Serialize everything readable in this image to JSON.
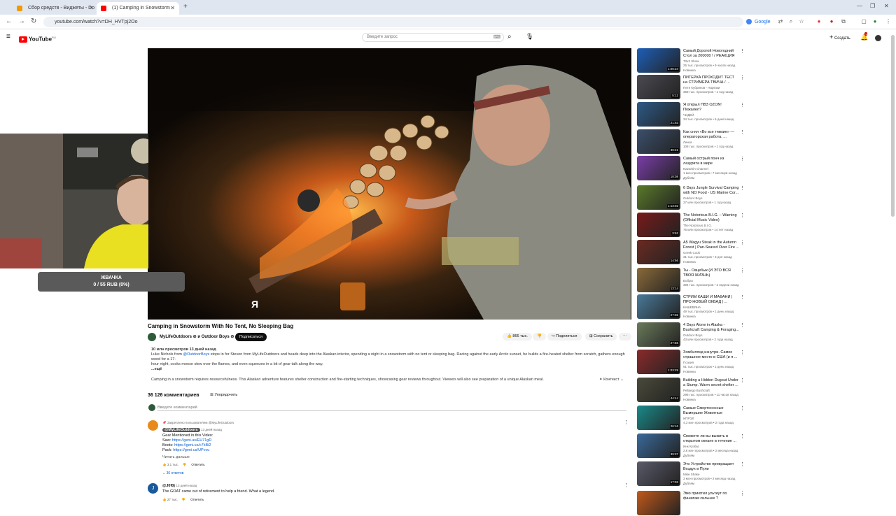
{
  "tabs": [
    {
      "title": "Сбор средств - Виджеты - Do",
      "color": "#f29900"
    },
    {
      "title": "(1) Camping in Snowstorm",
      "color": "#ff0000"
    }
  ],
  "address": {
    "url": "youtube.com/watch?v=DH_HVTpj2Oo"
  },
  "toolbar": {
    "google_label": "Google"
  },
  "header": {
    "logo_text": "YouTube",
    "logo_suffix": "RU",
    "search_placeholder": "Введите запрос",
    "create_label": "Создать",
    "notif_count": "1"
  },
  "donation": {
    "title": "ЖВАЧКА",
    "progress": "0 / 55 RUB (0%)",
    "progress_fraction": 0
  },
  "video": {
    "overlay_letter": "Я",
    "title": "Camping in Snowstorm With No Tent, No Sleeping Bag",
    "channel": "MyLifeOutdoors ⊘ и Outdoor Boys ⊘",
    "subscribe": "Подписаться",
    "likes": "866 тыс.",
    "share": "Поделиться",
    "save": "Сохранить",
    "views_line": "10 млн просмотров  13 дней назад",
    "desc1_a": "Luke Nichols from ",
    "desc1_link": "@OutdoorBoys",
    "desc1_b": " stops in for Steven from MyLifeOutdoors and heads deep into the Alaskan interior, spending a night in a snowstorm with no tent or sleeping bag. Racing against the early Arctic sunset, he builds a fire-heated shelter from scratch, gathers enough wood for a 17-",
    "desc2": "hour night, cooks moose stew over the flames, and even squeezes in a bit of gear talk along the way.",
    "more": "...ещё",
    "summary": "Camping in a snowstorm requires resourcefulness. This Alaskan adventure features shelter construction and fire-starting techniques, showcasing gear reviews throughout. Viewers will also see preparation of a unique Alaskan meal.",
    "context_btn": "Контекст"
  },
  "comments": {
    "count": "36 126 комментариев",
    "sort": "Упорядочить",
    "add_placeholder": "Введите комментарий",
    "pinned_label": "Закреплено пользователем @MyLifeOutdoors",
    "c1_author": "@MyLifeOutdoors",
    "c1_time": "13 дней назад",
    "c1_l1": "Gear Mentioned in this Video:",
    "c1_l2a": "Saw: ",
    "c1_l2b": "https://geni.us/EH71gR",
    "c1_l3a": "Boots: ",
    "c1_l3b": "https://geni.us/c7kBi2",
    "c1_l4a": "Pack: ",
    "c1_l4b": "https://geni.us/UPcvu",
    "c1_more": "Читать дальше",
    "c1_likes": "3,1 тыс.",
    "c1_reply": "Ответить",
    "c1_replies": "36 ответов",
    "c2_author": "@J0f0j",
    "c2_time": "13 дней назад",
    "c2_text": "The GOAT came out of retirement to help a friend.  What a legend.",
    "c2_likes": "27 тыс.",
    "c2_reply": "Ответить"
  },
  "sidebar": [
    {
      "title": "Самый Дорогой Новогодний Стол за 200000 ! / РЕАКЦИЯ",
      "channel": "T2x2 Show",
      "meta": "25 тыс. просмотров • 9 часов назад",
      "badge": "Новинка",
      "dur": "1:06:24",
      "color": "#1d5fb8"
    },
    {
      "title": "ПИТЕРКА ПРОХОДИТ ТЕСТ на СТРИМЕРА ТВИЧА / ...",
      "channel": "Петя Кубринов - Нарезки",
      "meta": "358 тыс. просмотров • 1 год назад",
      "badge": "",
      "dur": "5:12",
      "color": "#4a4a52"
    },
    {
      "title": "Я открыл ПВЗ OZON! Пожалел?",
      "channel": "ЧИДЕЙ",
      "meta": "34 тыс. просмотров • 6 дней назад",
      "badge": "",
      "dur": "21:53",
      "color": "#2d5a87"
    },
    {
      "title": "Как снял «Во все тяжкие» — операторская работа, ...",
      "channel": "Линза",
      "meta": "108 тыс. просмотров • 1 год назад",
      "badge": "",
      "dur": "30:21",
      "color": "#3b4f6b"
    },
    {
      "title": "Самый острый понч из лазурита в мире",
      "channel": "Nazarkin Channel",
      "meta": "1 млн просмотров • 7 месяцев назад",
      "badge": "Дублям",
      "dur": "18:08",
      "color": "#7a3ea8"
    },
    {
      "title": "6 Days Jungle Survival Camping with NO Food - US Marine Cor...",
      "channel": "Outdoor Boys",
      "meta": "37 млн просмотров • 1 год назад",
      "badge": "",
      "dur": "1:13:02",
      "color": "#5a7a2a"
    },
    {
      "title": "The Notorious B.I.G. – Warning (Official Music Video)",
      "channel": "The Notorious B.I.G.",
      "meta": "76 млн просмотров • 14 лет назад",
      "badge": "",
      "dur": "3:52",
      "color": "#7a1a1a"
    },
    {
      "title": "A5 Wagyu Steak in the Autumn Forest | Pan-Seared Over Fire ...",
      "channel": "Greek Cook",
      "meta": "31 тыс. просмотров • 3 дня назад",
      "badge": "Новинка",
      "dur": "14:56",
      "color": "#6b2a22"
    },
    {
      "title": "Ты - Овцебык (И ЭТО ВСЯ ТВОЯ ЖИЗНЬ)",
      "channel": "Бобры",
      "meta": "394 тыс. просмотров • 2 недели назад",
      "badge": "",
      "dur": "13:14",
      "color": "#8a6a3a"
    },
    {
      "title": "СТРИМ КАШИ И МАФАНИ | ПРО НОВЫЙ ОКВАД | ...",
      "channel": "КАШЕВЯНА",
      "meta": "49 тыс. просмотров • 1 день назад",
      "badge": "Новинка",
      "dur": "27:02",
      "color": "#4a7a9a"
    },
    {
      "title": "4 Days Alone in Alaska - Bushcraft Camping & Foraging...",
      "channel": "Outdoor Boys",
      "meta": "43 млн просмотров • 2 года назад",
      "badge": "",
      "dur": "27:56",
      "color": "#6a7a5a"
    },
    {
      "title": "Зомбилянд изнутри. Самое страшное место в США (и я ...",
      "channel": "Поэзия",
      "meta": "91 тыс. просмотров • 1 день назад",
      "badge": "Новинка",
      "dur": "1:03:29",
      "color": "#8a2a2a"
    },
    {
      "title": "Building a Hidden Dugout Under a Stump. Warm secret shelter ...",
      "channel": "Pellaego Bushcraft",
      "meta": "298 тыс. просмотров • 11 часов назад",
      "badge": "Новинка",
      "dur": "44:44",
      "color": "#4a4a3a"
    },
    {
      "title": "Самые Смертоносные Вымершие Животные",
      "channel": "ИПРЭЛ",
      "meta": "4,3 млн просмотров • 2 года назад",
      "badge": "",
      "dur": "26:16",
      "color": "#1a8a8a"
    },
    {
      "title": "Сможете ли вы выжить в открытом океане в течение ...",
      "channel": "Инк Кузбас",
      "meta": "2,6 млн просмотров • 2 месяца назад",
      "badge": "Дублям",
      "dur": "39:37",
      "color": "#3a6a9a"
    },
    {
      "title": "Это Устройство превращает Воздух в Пули",
      "channel": "Mike Shake",
      "meta": "3 млн просмотров • 2 месяца назад",
      "badge": "Дублям",
      "dur": "17:03",
      "color": "#5a5a6a"
    },
    {
      "title": "Эмо приютил ультиут по фанатам сильнее ?",
      "channel": "",
      "meta": "",
      "badge": "",
      "dur": "",
      "color": "#c25a1a"
    }
  ]
}
